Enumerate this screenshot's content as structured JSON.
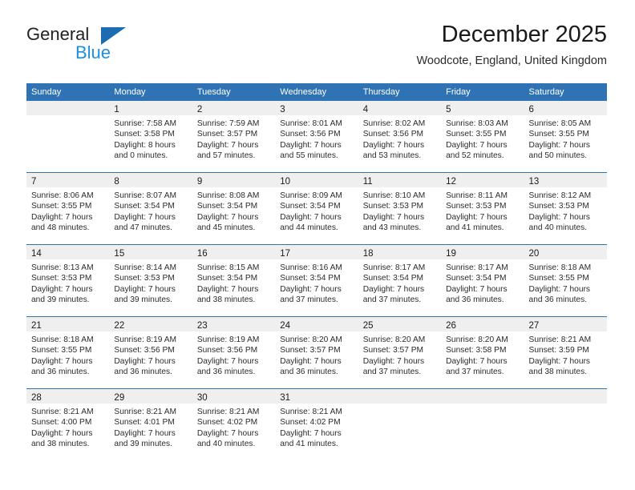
{
  "brand": {
    "name_dark": "General",
    "name_blue": "Blue",
    "logo_icon": "triangle-icon",
    "dark_color": "#231f20",
    "blue_color": "#1c8fe0",
    "triangle_color": "#1c6cb3"
  },
  "header": {
    "title": "December 2025",
    "subtitle": "Woodcote, England, United Kingdom"
  },
  "theme": {
    "header_blue": "#3073b5",
    "daynum_band": "#efefef",
    "cell_background": "#ffffff",
    "text_color": "#2b2b2b"
  },
  "calendar": {
    "weekday_headers": [
      "Sunday",
      "Monday",
      "Tuesday",
      "Wednesday",
      "Thursday",
      "Friday",
      "Saturday"
    ],
    "weeks": [
      [
        {
          "day": "",
          "lines": []
        },
        {
          "day": "1",
          "lines": [
            "Sunrise: 7:58 AM",
            "Sunset: 3:58 PM",
            "Daylight: 8 hours",
            "and 0 minutes."
          ]
        },
        {
          "day": "2",
          "lines": [
            "Sunrise: 7:59 AM",
            "Sunset: 3:57 PM",
            "Daylight: 7 hours",
            "and 57 minutes."
          ]
        },
        {
          "day": "3",
          "lines": [
            "Sunrise: 8:01 AM",
            "Sunset: 3:56 PM",
            "Daylight: 7 hours",
            "and 55 minutes."
          ]
        },
        {
          "day": "4",
          "lines": [
            "Sunrise: 8:02 AM",
            "Sunset: 3:56 PM",
            "Daylight: 7 hours",
            "and 53 minutes."
          ]
        },
        {
          "day": "5",
          "lines": [
            "Sunrise: 8:03 AM",
            "Sunset: 3:55 PM",
            "Daylight: 7 hours",
            "and 52 minutes."
          ]
        },
        {
          "day": "6",
          "lines": [
            "Sunrise: 8:05 AM",
            "Sunset: 3:55 PM",
            "Daylight: 7 hours",
            "and 50 minutes."
          ]
        }
      ],
      [
        {
          "day": "7",
          "lines": [
            "Sunrise: 8:06 AM",
            "Sunset: 3:55 PM",
            "Daylight: 7 hours",
            "and 48 minutes."
          ]
        },
        {
          "day": "8",
          "lines": [
            "Sunrise: 8:07 AM",
            "Sunset: 3:54 PM",
            "Daylight: 7 hours",
            "and 47 minutes."
          ]
        },
        {
          "day": "9",
          "lines": [
            "Sunrise: 8:08 AM",
            "Sunset: 3:54 PM",
            "Daylight: 7 hours",
            "and 45 minutes."
          ]
        },
        {
          "day": "10",
          "lines": [
            "Sunrise: 8:09 AM",
            "Sunset: 3:54 PM",
            "Daylight: 7 hours",
            "and 44 minutes."
          ]
        },
        {
          "day": "11",
          "lines": [
            "Sunrise: 8:10 AM",
            "Sunset: 3:53 PM",
            "Daylight: 7 hours",
            "and 43 minutes."
          ]
        },
        {
          "day": "12",
          "lines": [
            "Sunrise: 8:11 AM",
            "Sunset: 3:53 PM",
            "Daylight: 7 hours",
            "and 41 minutes."
          ]
        },
        {
          "day": "13",
          "lines": [
            "Sunrise: 8:12 AM",
            "Sunset: 3:53 PM",
            "Daylight: 7 hours",
            "and 40 minutes."
          ]
        }
      ],
      [
        {
          "day": "14",
          "lines": [
            "Sunrise: 8:13 AM",
            "Sunset: 3:53 PM",
            "Daylight: 7 hours",
            "and 39 minutes."
          ]
        },
        {
          "day": "15",
          "lines": [
            "Sunrise: 8:14 AM",
            "Sunset: 3:53 PM",
            "Daylight: 7 hours",
            "and 39 minutes."
          ]
        },
        {
          "day": "16",
          "lines": [
            "Sunrise: 8:15 AM",
            "Sunset: 3:54 PM",
            "Daylight: 7 hours",
            "and 38 minutes."
          ]
        },
        {
          "day": "17",
          "lines": [
            "Sunrise: 8:16 AM",
            "Sunset: 3:54 PM",
            "Daylight: 7 hours",
            "and 37 minutes."
          ]
        },
        {
          "day": "18",
          "lines": [
            "Sunrise: 8:17 AM",
            "Sunset: 3:54 PM",
            "Daylight: 7 hours",
            "and 37 minutes."
          ]
        },
        {
          "day": "19",
          "lines": [
            "Sunrise: 8:17 AM",
            "Sunset: 3:54 PM",
            "Daylight: 7 hours",
            "and 36 minutes."
          ]
        },
        {
          "day": "20",
          "lines": [
            "Sunrise: 8:18 AM",
            "Sunset: 3:55 PM",
            "Daylight: 7 hours",
            "and 36 minutes."
          ]
        }
      ],
      [
        {
          "day": "21",
          "lines": [
            "Sunrise: 8:18 AM",
            "Sunset: 3:55 PM",
            "Daylight: 7 hours",
            "and 36 minutes."
          ]
        },
        {
          "day": "22",
          "lines": [
            "Sunrise: 8:19 AM",
            "Sunset: 3:56 PM",
            "Daylight: 7 hours",
            "and 36 minutes."
          ]
        },
        {
          "day": "23",
          "lines": [
            "Sunrise: 8:19 AM",
            "Sunset: 3:56 PM",
            "Daylight: 7 hours",
            "and 36 minutes."
          ]
        },
        {
          "day": "24",
          "lines": [
            "Sunrise: 8:20 AM",
            "Sunset: 3:57 PM",
            "Daylight: 7 hours",
            "and 36 minutes."
          ]
        },
        {
          "day": "25",
          "lines": [
            "Sunrise: 8:20 AM",
            "Sunset: 3:57 PM",
            "Daylight: 7 hours",
            "and 37 minutes."
          ]
        },
        {
          "day": "26",
          "lines": [
            "Sunrise: 8:20 AM",
            "Sunset: 3:58 PM",
            "Daylight: 7 hours",
            "and 37 minutes."
          ]
        },
        {
          "day": "27",
          "lines": [
            "Sunrise: 8:21 AM",
            "Sunset: 3:59 PM",
            "Daylight: 7 hours",
            "and 38 minutes."
          ]
        }
      ],
      [
        {
          "day": "28",
          "lines": [
            "Sunrise: 8:21 AM",
            "Sunset: 4:00 PM",
            "Daylight: 7 hours",
            "and 38 minutes."
          ]
        },
        {
          "day": "29",
          "lines": [
            "Sunrise: 8:21 AM",
            "Sunset: 4:01 PM",
            "Daylight: 7 hours",
            "and 39 minutes."
          ]
        },
        {
          "day": "30",
          "lines": [
            "Sunrise: 8:21 AM",
            "Sunset: 4:02 PM",
            "Daylight: 7 hours",
            "and 40 minutes."
          ]
        },
        {
          "day": "31",
          "lines": [
            "Sunrise: 8:21 AM",
            "Sunset: 4:02 PM",
            "Daylight: 7 hours",
            "and 41 minutes."
          ]
        },
        {
          "day": "",
          "lines": []
        },
        {
          "day": "",
          "lines": []
        },
        {
          "day": "",
          "lines": []
        }
      ]
    ]
  }
}
